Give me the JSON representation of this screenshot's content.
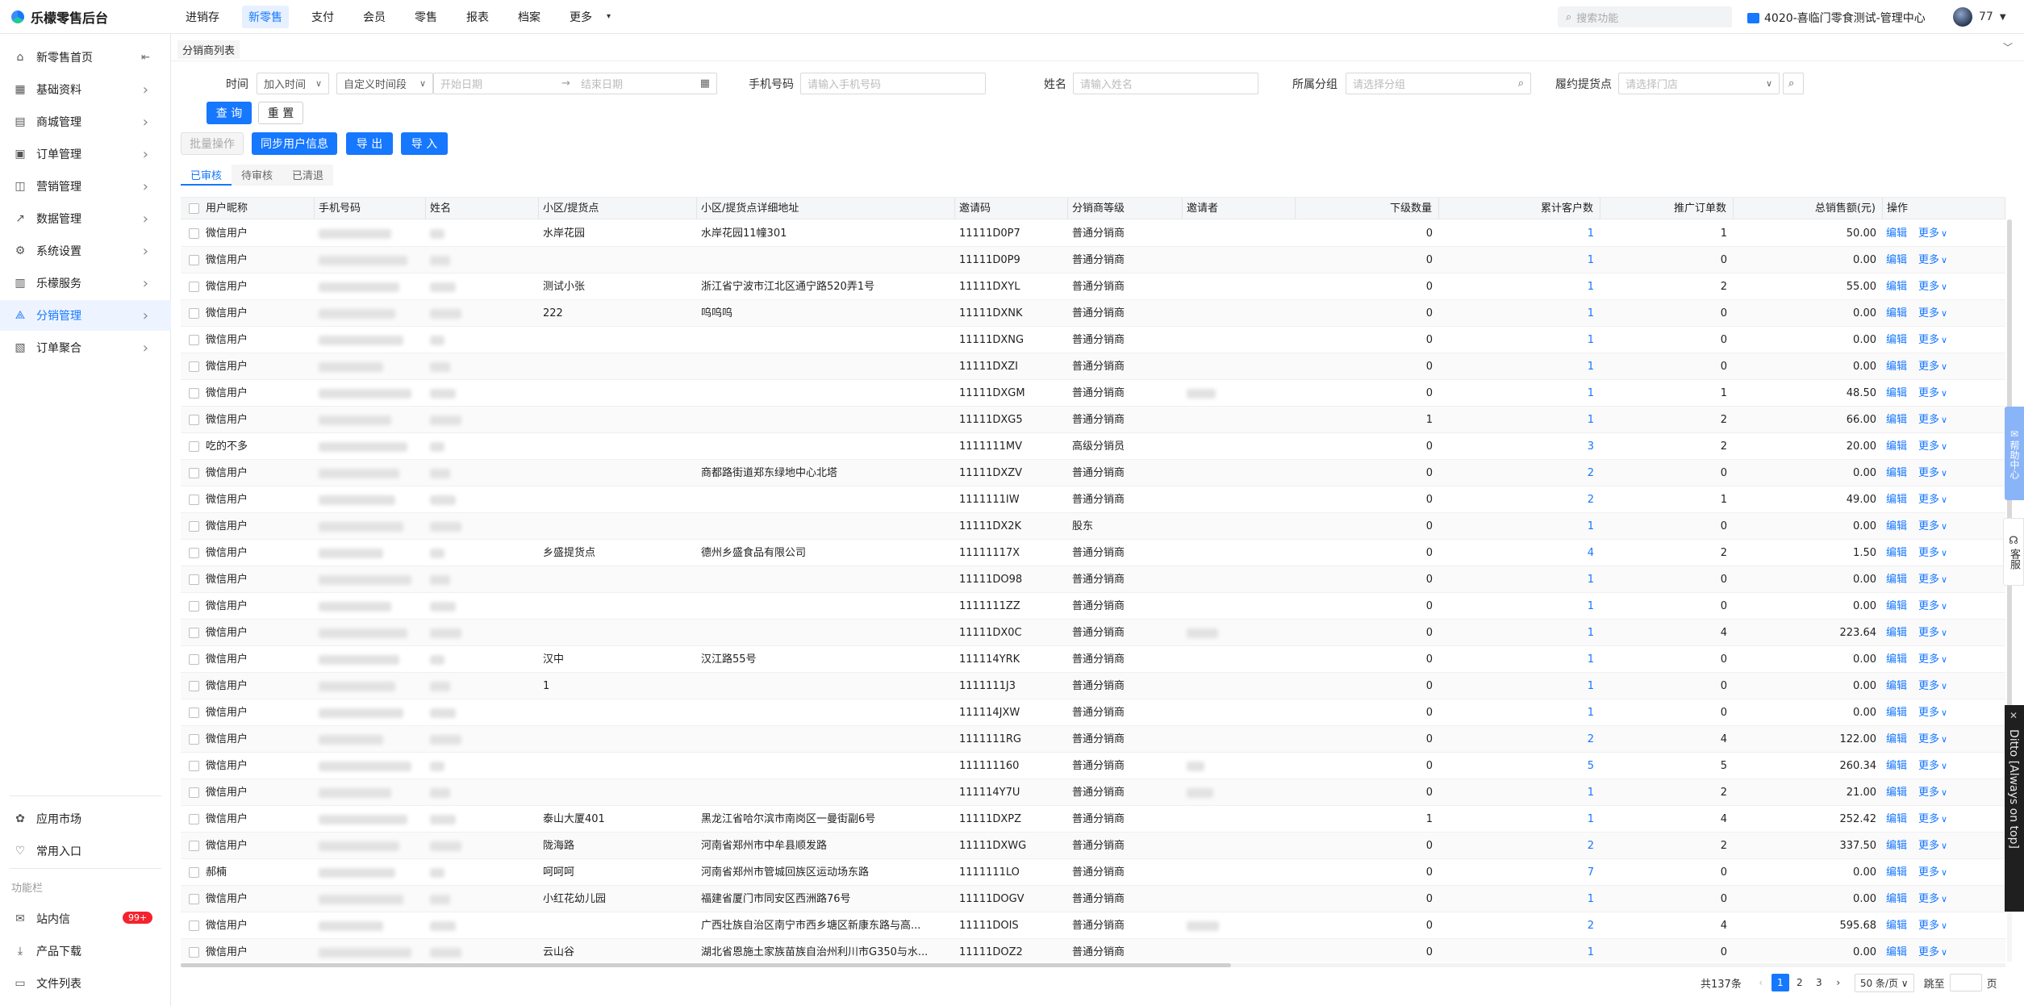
{
  "app": {
    "title": "乐檬零售后台"
  },
  "topnav": [
    "进销存",
    "新零售",
    "支付",
    "会员",
    "零售",
    "报表",
    "档案",
    "更多"
  ],
  "topnav_active": 1,
  "search": {
    "placeholder": "搜索功能"
  },
  "store": {
    "name": "4020-喜临门零食测试-管理中心"
  },
  "user": {
    "name": "77"
  },
  "sidebar": {
    "items": [
      {
        "label": "新零售首页",
        "icon": "home-icon"
      },
      {
        "label": "基础资料",
        "icon": "grid-icon"
      },
      {
        "label": "商城管理",
        "icon": "shop-icon"
      },
      {
        "label": "订单管理",
        "icon": "order-icon"
      },
      {
        "label": "营销管理",
        "icon": "marketing-icon"
      },
      {
        "label": "数据管理",
        "icon": "chart-icon"
      },
      {
        "label": "系统设置",
        "icon": "gear-icon"
      },
      {
        "label": "乐檬服务",
        "icon": "service-icon"
      },
      {
        "label": "分销管理",
        "icon": "distribution-icon"
      },
      {
        "label": "订单聚合",
        "icon": "order-aggregate-icon"
      }
    ],
    "active_index": 8,
    "bottom": [
      {
        "label": "应用市场",
        "icon": "app-market-icon"
      },
      {
        "label": "常用入口",
        "icon": "heart-icon"
      }
    ],
    "section_label": "功能栏",
    "tools": [
      {
        "label": "站内信",
        "icon": "message-icon",
        "badge": "99+"
      },
      {
        "label": "产品下载",
        "icon": "download-icon"
      },
      {
        "label": "文件列表",
        "icon": "file-icon"
      }
    ]
  },
  "page_tab": "分销商列表",
  "filters": {
    "time_label": "时间",
    "time_type": "加入时间",
    "time_range": "自定义时间段",
    "start_placeholder": "开始日期",
    "end_placeholder": "结束日期",
    "phone_label": "手机号码",
    "phone_placeholder": "请输入手机号码",
    "name_label": "姓名",
    "name_placeholder": "请输入姓名",
    "group_label": "所属分组",
    "group_placeholder": "请选择分组",
    "pickup_label": "履约提货点",
    "pickup_placeholder": "请选择门店",
    "query": "查 询",
    "reset": "重 置"
  },
  "actions": {
    "batch": "批量操作",
    "sync": "同步用户信息",
    "export": "导 出",
    "import": "导 入"
  },
  "subtabs": [
    "已审核",
    "待审核",
    "已清退"
  ],
  "columns": [
    "用户昵称",
    "手机号码",
    "姓名",
    "小区/提货点",
    "小区/提货点详细地址",
    "邀请码",
    "分销商等级",
    "邀请者",
    "下级数量",
    "累计客户数",
    "推广订单数",
    "总销售额(元)",
    "操作"
  ],
  "ops": {
    "edit": "编辑",
    "more": "更多"
  },
  "rows": [
    {
      "nick": "微信用户",
      "point": "水岸花园",
      "addr": "水岸花园11幢301",
      "code": "11111D0P7",
      "level": "普通分销商",
      "inviter": false,
      "sub": "0",
      "cust": "1",
      "orders": "1",
      "sales": "50.00"
    },
    {
      "nick": "微信用户",
      "point": "",
      "addr": "",
      "code": "11111D0P9",
      "level": "普通分销商",
      "inviter": false,
      "sub": "0",
      "cust": "1",
      "orders": "0",
      "sales": "0.00"
    },
    {
      "nick": "微信用户",
      "point": "测试小张",
      "addr": "浙江省宁波市江北区通宁路520弄1号",
      "code": "11111DXYL",
      "level": "普通分销商",
      "inviter": false,
      "sub": "0",
      "cust": "1",
      "orders": "2",
      "sales": "55.00"
    },
    {
      "nick": "微信用户",
      "point": "222",
      "addr": "呜呜呜",
      "code": "11111DXNK",
      "level": "普通分销商",
      "inviter": false,
      "sub": "0",
      "cust": "1",
      "orders": "0",
      "sales": "0.00"
    },
    {
      "nick": "微信用户",
      "point": "",
      "addr": "",
      "code": "11111DXNG",
      "level": "普通分销商",
      "inviter": false,
      "sub": "0",
      "cust": "1",
      "orders": "0",
      "sales": "0.00"
    },
    {
      "nick": "微信用户",
      "point": "",
      "addr": "",
      "code": "11111DXZI",
      "level": "普通分销商",
      "inviter": false,
      "sub": "0",
      "cust": "1",
      "orders": "0",
      "sales": "0.00"
    },
    {
      "nick": "微信用户",
      "point": "",
      "addr": "",
      "code": "11111DXGM",
      "level": "普通分销商",
      "inviter": true,
      "sub": "0",
      "cust": "1",
      "orders": "1",
      "sales": "48.50"
    },
    {
      "nick": "微信用户",
      "point": "",
      "addr": "",
      "code": "11111DXG5",
      "level": "普通分销商",
      "inviter": false,
      "sub": "1",
      "cust": "1",
      "orders": "2",
      "sales": "66.00"
    },
    {
      "nick": "吃的不多",
      "point": "",
      "addr": "",
      "code": "1111111MV",
      "level": "高级分销员",
      "inviter": false,
      "sub": "0",
      "cust": "3",
      "orders": "2",
      "sales": "20.00"
    },
    {
      "nick": "微信用户",
      "point": "",
      "addr": "商都路街道郑东绿地中心北塔",
      "code": "11111DXZV",
      "level": "普通分销商",
      "inviter": false,
      "sub": "0",
      "cust": "2",
      "orders": "0",
      "sales": "0.00"
    },
    {
      "nick": "微信用户",
      "point": "",
      "addr": "",
      "code": "1111111IW",
      "level": "普通分销商",
      "inviter": false,
      "sub": "0",
      "cust": "2",
      "orders": "1",
      "sales": "49.00"
    },
    {
      "nick": "微信用户",
      "point": "",
      "addr": "",
      "code": "11111DX2K",
      "level": "股东",
      "inviter": false,
      "sub": "0",
      "cust": "1",
      "orders": "0",
      "sales": "0.00"
    },
    {
      "nick": "微信用户",
      "point": "乡盛提货点",
      "addr": "德州乡盛食品有限公司",
      "code": "11111117X",
      "level": "普通分销商",
      "inviter": false,
      "sub": "0",
      "cust": "4",
      "orders": "2",
      "sales": "1.50"
    },
    {
      "nick": "微信用户",
      "point": "",
      "addr": "",
      "code": "11111DO98",
      "level": "普通分销商",
      "inviter": false,
      "sub": "0",
      "cust": "1",
      "orders": "0",
      "sales": "0.00"
    },
    {
      "nick": "微信用户",
      "point": "",
      "addr": "",
      "code": "1111111ZZ",
      "level": "普通分销商",
      "inviter": false,
      "sub": "0",
      "cust": "1",
      "orders": "0",
      "sales": "0.00"
    },
    {
      "nick": "微信用户",
      "point": "",
      "addr": "",
      "code": "11111DX0C",
      "level": "普通分销商",
      "inviter": true,
      "sub": "0",
      "cust": "1",
      "orders": "4",
      "sales": "223.64"
    },
    {
      "nick": "微信用户",
      "point": "汉中",
      "addr": "汉江路55号",
      "code": "111114YRK",
      "level": "普通分销商",
      "inviter": false,
      "sub": "0",
      "cust": "1",
      "orders": "0",
      "sales": "0.00"
    },
    {
      "nick": "微信用户",
      "point": "1",
      "addr": "",
      "code": "1111111J3",
      "level": "普通分销商",
      "inviter": false,
      "sub": "0",
      "cust": "1",
      "orders": "0",
      "sales": "0.00"
    },
    {
      "nick": "微信用户",
      "point": "",
      "addr": "",
      "code": "111114JXW",
      "level": "普通分销商",
      "inviter": false,
      "sub": "0",
      "cust": "1",
      "orders": "0",
      "sales": "0.00"
    },
    {
      "nick": "微信用户",
      "point": "",
      "addr": "",
      "code": "1111111RG",
      "level": "普通分销商",
      "inviter": false,
      "sub": "0",
      "cust": "2",
      "orders": "4",
      "sales": "122.00"
    },
    {
      "nick": "微信用户",
      "point": "",
      "addr": "",
      "code": "111111160",
      "level": "普通分销商",
      "inviter": true,
      "sub": "0",
      "cust": "5",
      "orders": "5",
      "sales": "260.34"
    },
    {
      "nick": "微信用户",
      "point": "",
      "addr": "",
      "code": "111114Y7U",
      "level": "普通分销商",
      "inviter": true,
      "sub": "0",
      "cust": "1",
      "orders": "2",
      "sales": "21.00"
    },
    {
      "nick": "微信用户",
      "point": "泰山大厦401",
      "addr": "黑龙江省哈尔滨市南岗区一曼街副6号",
      "code": "11111DXPZ",
      "level": "普通分销商",
      "inviter": false,
      "sub": "1",
      "cust": "1",
      "orders": "4",
      "sales": "252.42"
    },
    {
      "nick": "微信用户",
      "point": "陇海路",
      "addr": "河南省郑州市中牟县顺发路",
      "code": "11111DXWG",
      "level": "普通分销商",
      "inviter": false,
      "sub": "0",
      "cust": "2",
      "orders": "2",
      "sales": "337.50"
    },
    {
      "nick": "郝楠",
      "point": "呵呵呵",
      "addr": "河南省郑州市管城回族区运动场东路",
      "code": "1111111LO",
      "level": "普通分销商",
      "inviter": false,
      "sub": "0",
      "cust": "7",
      "orders": "0",
      "sales": "0.00"
    },
    {
      "nick": "微信用户",
      "point": "小红花幼儿园",
      "addr": "福建省厦门市同安区西洲路76号",
      "code": "11111DOGV",
      "level": "普通分销商",
      "inviter": false,
      "sub": "0",
      "cust": "1",
      "orders": "0",
      "sales": "0.00"
    },
    {
      "nick": "微信用户",
      "point": "",
      "addr": "广西壮族自治区南宁市西乡塘区新康东路与高...",
      "code": "11111DOIS",
      "level": "普通分销商",
      "inviter": true,
      "sub": "0",
      "cust": "2",
      "orders": "4",
      "sales": "595.68"
    },
    {
      "nick": "微信用户",
      "point": "云山谷",
      "addr": "湖北省恩施土家族苗族自治州利川市G350与水...",
      "code": "11111DOZ2",
      "level": "普通分销商",
      "inviter": false,
      "sub": "0",
      "cust": "1",
      "orders": "0",
      "sales": "0.00"
    }
  ],
  "pager": {
    "total": "共137条",
    "pages": [
      "1",
      "2",
      "3"
    ],
    "size": "50 条/页",
    "jump": "跳至",
    "page_unit": "页"
  },
  "help": "帮助中心",
  "service": "客服",
  "ditto": "Ditto [Always on top]",
  "accent": "#1677ff"
}
